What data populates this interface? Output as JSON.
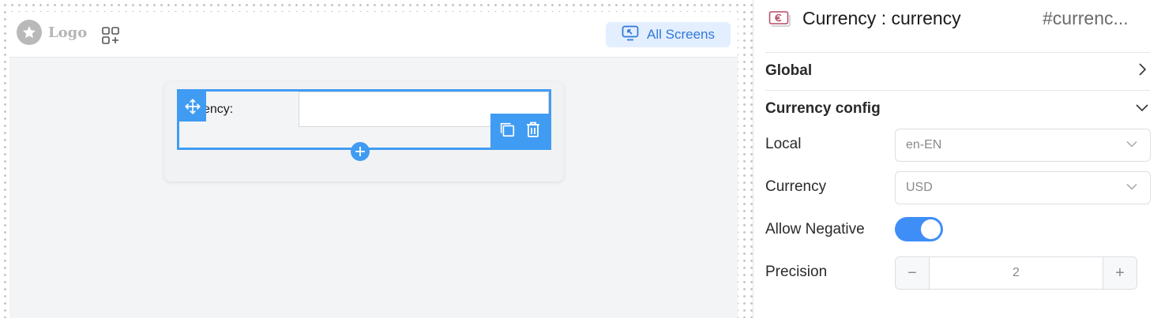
{
  "canvas": {
    "logo": {
      "text": "Logo",
      "icon": "star-icon"
    },
    "apps_icon": "add-grid-icon",
    "all_screens": {
      "label": "All Screens",
      "icon": "screen-icon"
    },
    "component": {
      "label": "ency:",
      "move_icon": "move-icon",
      "duplicate_icon": "copy-icon",
      "delete_icon": "trash-icon",
      "add_icon": "plus-icon"
    }
  },
  "panel": {
    "header": {
      "icon": "currency-note-icon",
      "title": "Currency : currency",
      "id": "#currenc..."
    },
    "sections": {
      "global": {
        "title": "Global",
        "icon": "chevron-right-icon"
      },
      "currency_config": {
        "title": "Currency config",
        "icon": "chevron-down-icon"
      }
    },
    "fields": {
      "local": {
        "label": "Local",
        "value": "en-EN"
      },
      "currency": {
        "label": "Currency",
        "value": "USD"
      },
      "allow_negative": {
        "label": "Allow Negative",
        "enabled": true
      },
      "precision": {
        "label": "Precision",
        "value": "2",
        "minus": "−",
        "plus": "+"
      }
    }
  },
  "colors": {
    "accent": "#409cf2",
    "toggle_on": "#3f8ef7",
    "all_screens_bg": "#e3efff",
    "all_screens_text": "#3277d9"
  }
}
